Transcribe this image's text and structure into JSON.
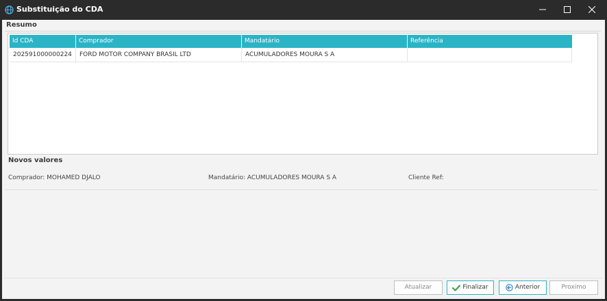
{
  "window": {
    "title": "Substituição do CDA",
    "icon": "globe-icon",
    "controls": [
      "minimize-icon",
      "maximize-icon",
      "close-icon"
    ]
  },
  "resumo": {
    "title": "Resumo",
    "columns": [
      "Id CDA",
      "Comprador",
      "Mandatário",
      "Referência"
    ],
    "rows": [
      {
        "id_cda": "202591000000224",
        "comprador": "FORD MOTOR COMPANY BRASIL LTD",
        "mandatario": "ACUMULADORES MOURA S A",
        "referencia": ""
      }
    ]
  },
  "novos_valores": {
    "title": "Novos valores",
    "comprador": "Comprador: MOHAMED DJALO",
    "mandatario": "Mandatário: ACUMULADORES MOURA S A",
    "cliente_ref": "Cliente Ref:"
  },
  "buttons": {
    "atualizar": "Atualizar",
    "finalizar": "Finalizar",
    "anterior": "Anterior",
    "proximo": "Proximo"
  },
  "colors": {
    "accent": "#2ab4c6",
    "titlebar": "#2b2b2b",
    "check_green": "#3aa64a"
  }
}
